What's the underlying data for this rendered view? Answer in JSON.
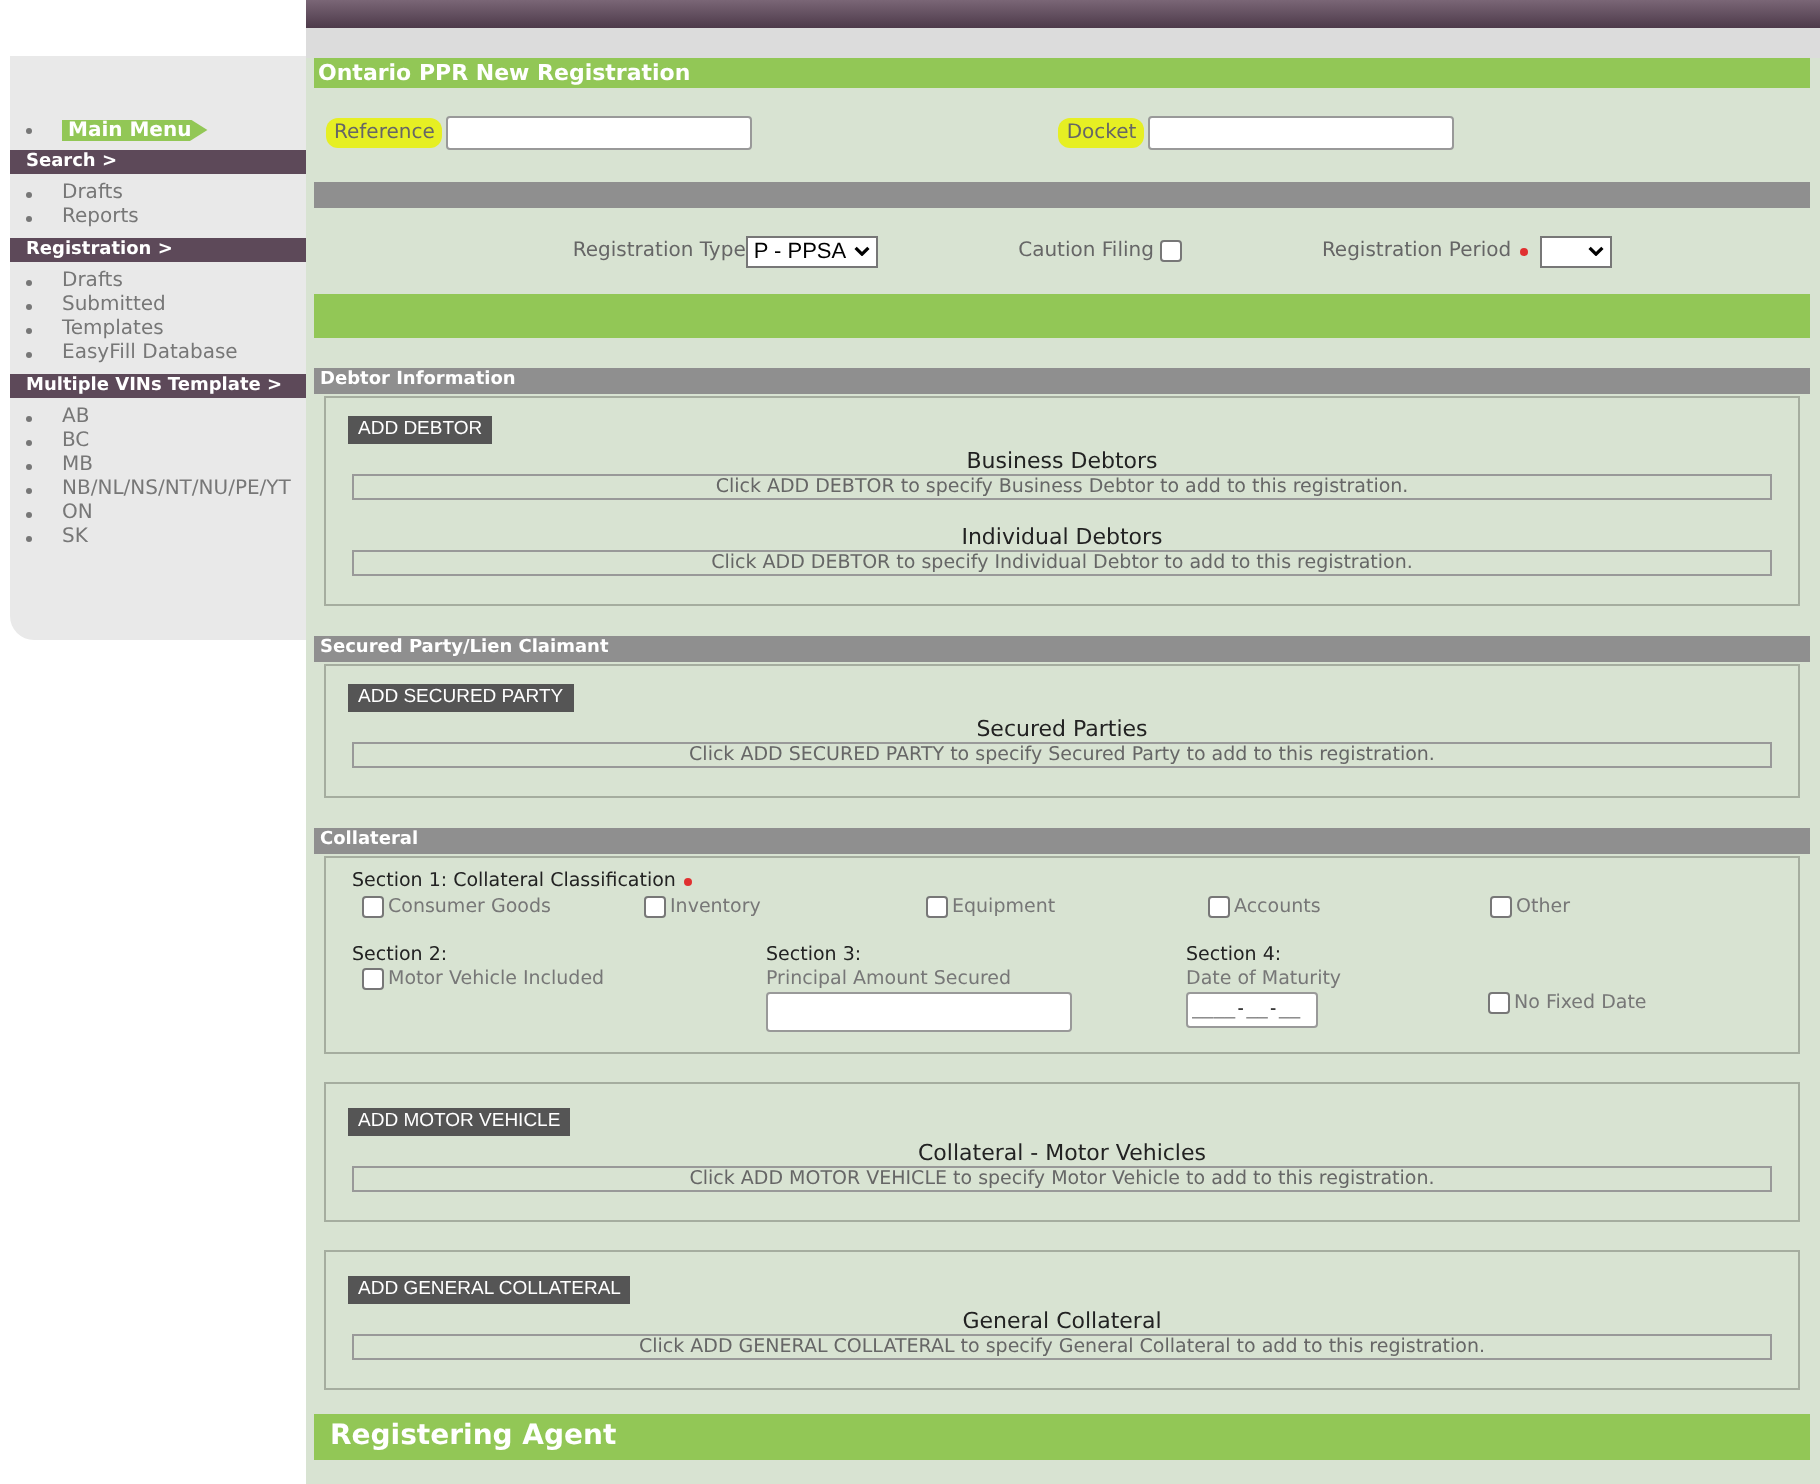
{
  "sidebar": {
    "main_menu": "Main Menu",
    "groups": [
      {
        "title": "Search >",
        "items": [
          "Drafts",
          "Reports"
        ]
      },
      {
        "title": "Registration >",
        "items": [
          "Drafts",
          "Submitted",
          "Templates",
          "EasyFill Database"
        ]
      },
      {
        "title": "Multiple VINs Template >",
        "items": [
          "AB",
          "BC",
          "MB",
          "NB/NL/NS/NT/NU/PE/YT",
          "ON",
          "SK"
        ]
      }
    ]
  },
  "title": "Ontario PPR New Registration",
  "reference": {
    "label": "Reference",
    "highlighted": true
  },
  "docket": {
    "label": "Docket",
    "highlighted": true
  },
  "registration_type": {
    "label": "Registration Type",
    "value": "P - PPSA"
  },
  "caution_filing": {
    "label": "Caution Filing",
    "checked": false
  },
  "registration_period": {
    "label": "Registration Period",
    "required": true
  },
  "sections": [
    {
      "kind": "panels",
      "title": "Debtor Information",
      "panels": [
        {
          "button": "ADD DEBTOR",
          "lists": [
            {
              "heading": "Business Debtors",
              "message": "Click ADD DEBTOR to specify Business Debtor to add to this registration."
            },
            {
              "heading": "Individual Debtors",
              "message": "Click ADD DEBTOR to specify Individual Debtor to add to this registration."
            }
          ]
        }
      ]
    },
    {
      "kind": "panels",
      "title": "Secured Party/Lien Claimant",
      "panels": [
        {
          "button": "ADD SECURED PARTY",
          "lists": [
            {
              "heading": "Secured Parties",
              "message": "Click ADD SECURED PARTY to specify Secured Party to add to this registration."
            }
          ]
        }
      ]
    },
    {
      "kind": "collateral",
      "title": "Collateral",
      "section1": {
        "label": "Section 1: Collateral Classification",
        "required": true,
        "options": [
          {
            "label": "Consumer Goods",
            "checked": false
          },
          {
            "label": "Inventory",
            "checked": false
          },
          {
            "label": "Equipment",
            "checked": false
          },
          {
            "label": "Accounts",
            "checked": false
          },
          {
            "label": "Other",
            "checked": false
          }
        ]
      },
      "section2": {
        "label": "Section 2:",
        "option": {
          "label": "Motor Vehicle Included",
          "checked": false
        }
      },
      "section3": {
        "label": "Section 3:",
        "field_label": "Principal Amount Secured"
      },
      "section4": {
        "label": "Section 4:",
        "field_label": "Date of Maturity",
        "placeholder": "____-__-__",
        "option": {
          "label": "No Fixed Date",
          "checked": false
        }
      },
      "panels": [
        {
          "button": "ADD MOTOR VEHICLE",
          "lists": [
            {
              "heading": "Collateral - Motor Vehicles",
              "message": "Click ADD MOTOR VEHICLE to specify Motor Vehicle to add to this registration."
            }
          ]
        },
        {
          "button": "ADD GENERAL COLLATERAL",
          "lists": [
            {
              "heading": "General Collateral",
              "message": "Click ADD GENERAL COLLATERAL to specify General Collateral to add to this registration."
            }
          ]
        }
      ]
    }
  ],
  "footer": "Registering Agent"
}
